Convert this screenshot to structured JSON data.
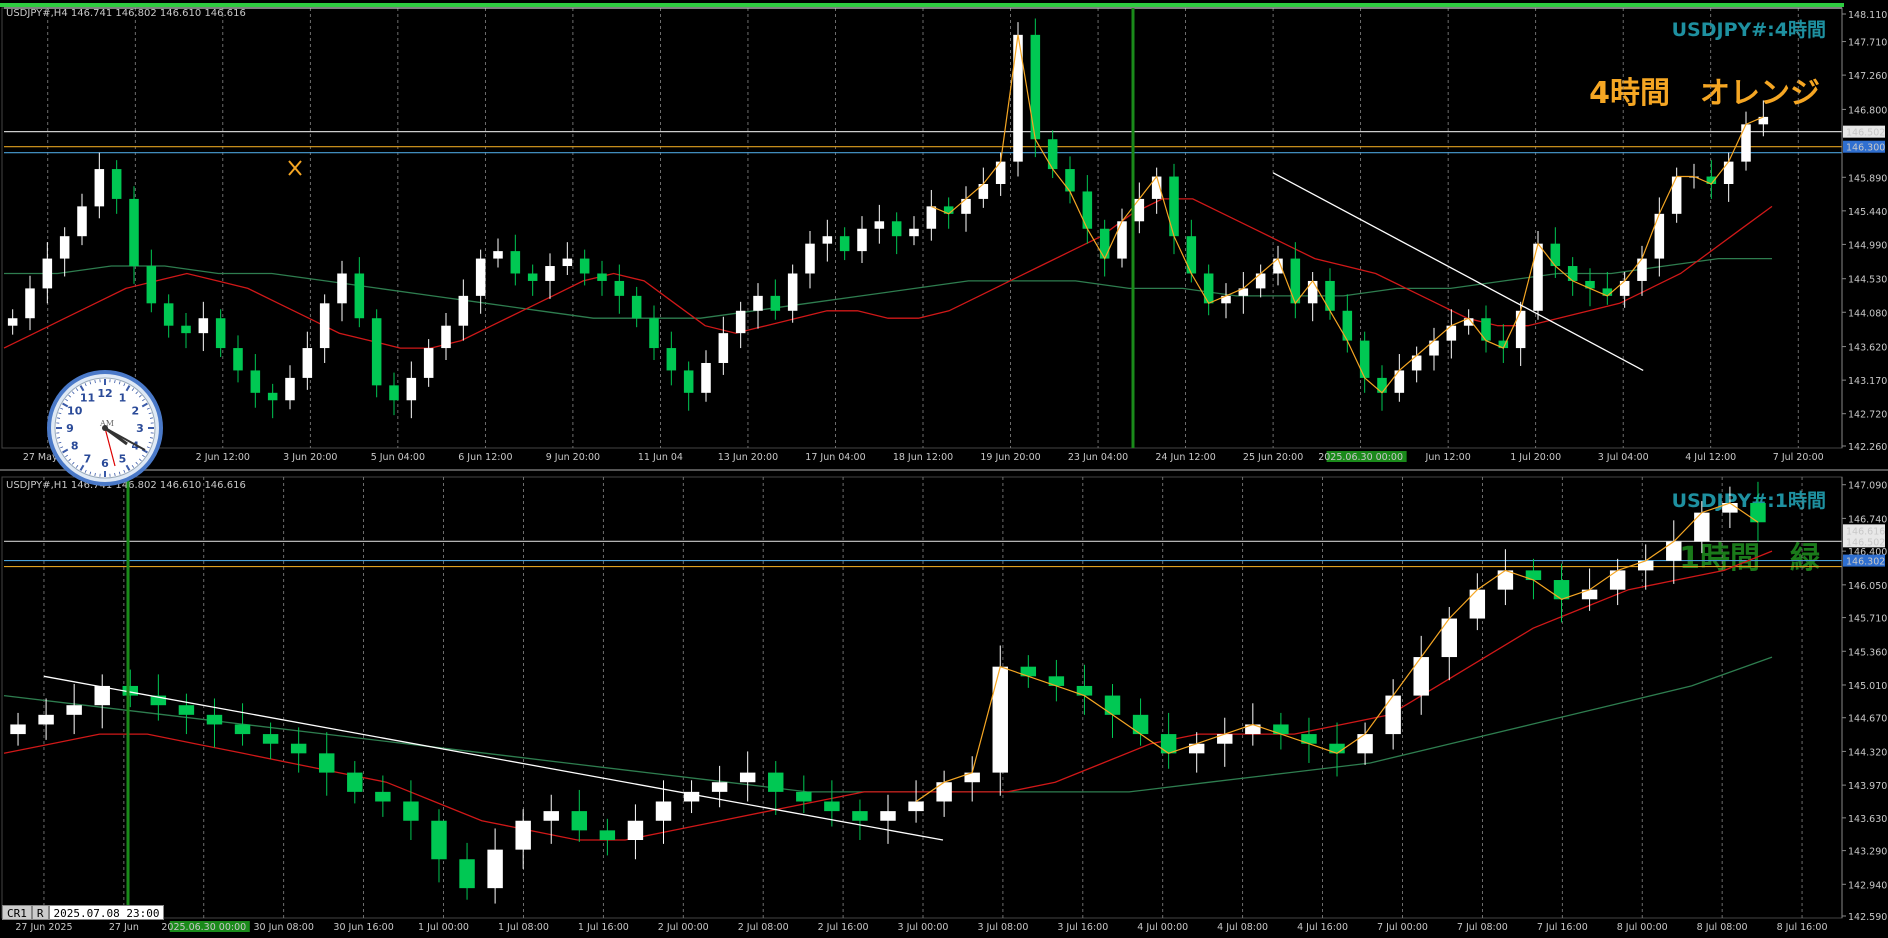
{
  "window": {
    "top_panel_header": "USDJPY#,H4  146.741 146.802 146.610 146.616",
    "bottom_panel_header": "USDJPY#,H1  146.741 146.802 146.610 146.616"
  },
  "chart_data": [
    {
      "type": "candlestick",
      "symbol": "USDJPY#",
      "timeframe": "H4",
      "overlay_title": "USDJPY#:4時間",
      "overlay_note": "4時間　オレンジ",
      "y_ticks": [
        "148.110",
        "147.710",
        "147.260",
        "146.800",
        "146.502",
        "146.300",
        "145.890",
        "145.440",
        "144.990",
        "144.530",
        "144.080",
        "143.620",
        "143.170",
        "142.720",
        "142.260"
      ],
      "price_labels": [
        "146.616",
        "146.502",
        "146.300"
      ],
      "ylim": [
        142.26,
        148.16
      ],
      "x_tick_labels": [
        "27 May 20",
        "04:00",
        "2 Jun 12:00",
        "3 Jun 20:00",
        "5 Jun 04:00",
        "6 Jun 12:00",
        "9 Jun 20:00",
        "11 Jun 04",
        "13 Jun 20:00",
        "17 Jun 04:00",
        "18 Jun 12:00",
        "19 Jun 20:00",
        "23 Jun 04:00",
        "24 Jun 12:00",
        "25 Jun 20:00",
        "2025.06.30 00:00",
        "Jun 12:00",
        "1 Jul 20:00",
        "3 Jul 04:00",
        "4 Jul 12:00",
        "7 Jul 20:00"
      ],
      "highlight_x_label": "2025.06.30 00:00",
      "close_series_approx": [
        144.0,
        144.4,
        144.8,
        145.1,
        145.5,
        146.0,
        145.6,
        144.7,
        144.2,
        143.9,
        143.8,
        144.0,
        143.6,
        143.3,
        143.0,
        142.9,
        143.2,
        143.6,
        144.2,
        144.6,
        144.0,
        143.1,
        142.9,
        143.2,
        143.6,
        143.9,
        144.3,
        144.8,
        144.9,
        144.6,
        144.5,
        144.7,
        144.8,
        144.6,
        144.5,
        144.3,
        144.0,
        143.6,
        143.3,
        143.0,
        143.4,
        143.8,
        144.1,
        144.3,
        144.1,
        144.6,
        145.0,
        145.1,
        144.9,
        145.2,
        145.3,
        145.1,
        145.2,
        145.5,
        145.4,
        145.6,
        145.8,
        146.1,
        147.8,
        146.4,
        146.0,
        145.7,
        145.2,
        144.8,
        145.3,
        145.6,
        145.9,
        145.1,
        144.6,
        144.2,
        144.3,
        144.4,
        144.6,
        144.8,
        144.2,
        144.5,
        144.1,
        143.7,
        143.2,
        143.0,
        143.3,
        143.5,
        143.7,
        143.9,
        144.0,
        143.7,
        143.6,
        144.1,
        145.0,
        144.7,
        144.5,
        144.4,
        144.3,
        144.5,
        144.8,
        145.4,
        145.9,
        145.9,
        145.8,
        146.1,
        146.6,
        146.7
      ],
      "ma_red_approx": [
        143.6,
        143.8,
        144.0,
        144.2,
        144.4,
        144.5,
        144.6,
        144.5,
        144.4,
        144.2,
        144.0,
        143.8,
        143.7,
        143.6,
        143.6,
        143.7,
        143.9,
        144.1,
        144.3,
        144.5,
        144.6,
        144.5,
        144.2,
        143.9,
        143.8,
        143.9,
        144.0,
        144.1,
        144.1,
        144.0,
        144.0,
        144.1,
        144.3,
        144.5,
        144.7,
        144.9,
        145.1,
        145.4,
        145.6,
        145.6,
        145.4,
        145.2,
        145.0,
        144.8,
        144.7,
        144.6,
        144.4,
        144.2,
        144.0,
        143.9,
        143.9,
        144.0,
        144.1,
        144.2,
        144.4,
        144.6,
        144.9,
        145.2,
        145.5
      ],
      "ma_green_approx": [
        144.6,
        144.6,
        144.7,
        144.7,
        144.6,
        144.6,
        144.5,
        144.4,
        144.3,
        144.2,
        144.1,
        144.0,
        144.0,
        144.0,
        144.1,
        144.2,
        144.3,
        144.4,
        144.5,
        144.5,
        144.5,
        144.4,
        144.4,
        144.3,
        144.3,
        144.3,
        144.4,
        144.4,
        144.5,
        144.6,
        144.6,
        144.7,
        144.8,
        144.8
      ],
      "horizontal_lines": [
        148.16,
        146.502,
        146.3,
        146.22
      ],
      "trendline": {
        "x_from": "25 Jun 20:00",
        "y_from": 145.95,
        "x_to": "3 Jul 04:00",
        "y_to": 143.3
      }
    },
    {
      "type": "candlestick",
      "symbol": "USDJPY#",
      "timeframe": "H1",
      "overlay_title": "USDJPY#:1時間",
      "overlay_note": "1時間　緑",
      "y_ticks": [
        "147.090",
        "146.740",
        "146.616",
        "146.502",
        "146.400",
        "146.302",
        "146.050",
        "145.710",
        "145.360",
        "145.010",
        "144.670",
        "144.320",
        "143.970",
        "143.630",
        "143.290",
        "142.940",
        "142.590"
      ],
      "price_labels": [
        "146.616",
        "146.502",
        "146.302"
      ],
      "ylim": [
        142.59,
        147.17
      ],
      "x_tick_labels": [
        "27 Jun 2025",
        "27 Jun",
        "2025.06.30 00:00",
        "30 Jun 08:00",
        "30 Jun 16:00",
        "1 Jul 00:00",
        "1 Jul 08:00",
        "1 Jul 16:00",
        "2 Jul 00:00",
        "2 Jul 08:00",
        "2 Jul 16:00",
        "3 Jul 00:00",
        "3 Jul 08:00",
        "3 Jul 16:00",
        "4 Jul 00:00",
        "4 Jul 08:00",
        "4 Jul 16:00",
        "7 Jul 00:00",
        "7 Jul 08:00",
        "7 Jul 16:00",
        "8 Jul 00:00",
        "8 Jul 08:00",
        "8 Jul 16:00"
      ],
      "highlight_x_label": "2025.06.30 00:00",
      "close_series_approx": [
        144.6,
        144.7,
        144.8,
        145.0,
        144.9,
        144.8,
        144.7,
        144.6,
        144.5,
        144.4,
        144.3,
        144.1,
        143.9,
        143.8,
        143.6,
        143.2,
        142.9,
        143.3,
        143.6,
        143.7,
        143.5,
        143.4,
        143.6,
        143.8,
        143.9,
        144.0,
        144.1,
        143.9,
        143.8,
        143.7,
        143.6,
        143.7,
        143.8,
        144.0,
        144.1,
        145.2,
        145.1,
        145.0,
        144.9,
        144.7,
        144.5,
        144.3,
        144.4,
        144.5,
        144.6,
        144.5,
        144.4,
        144.3,
        144.5,
        144.9,
        145.3,
        145.7,
        146.0,
        146.2,
        146.1,
        145.9,
        146.0,
        146.2,
        146.3,
        146.5,
        146.8,
        146.9,
        146.7
      ],
      "ma_red_approx": [
        144.3,
        144.4,
        144.5,
        144.5,
        144.4,
        144.3,
        144.2,
        144.1,
        144.0,
        143.8,
        143.6,
        143.5,
        143.4,
        143.4,
        143.5,
        143.6,
        143.7,
        143.8,
        143.9,
        143.9,
        143.9,
        143.9,
        144.0,
        144.2,
        144.4,
        144.5,
        144.5,
        144.5,
        144.6,
        144.7,
        145.0,
        145.3,
        145.6,
        145.8,
        146.0,
        146.1,
        146.2,
        146.4
      ],
      "ma_green_approx": [
        144.9,
        144.8,
        144.7,
        144.6,
        144.5,
        144.4,
        144.3,
        144.2,
        144.1,
        144.0,
        143.9,
        143.9,
        143.9,
        143.9,
        143.9,
        144.0,
        144.1,
        144.2,
        144.4,
        144.6,
        144.8,
        145.0,
        145.3
      ],
      "horizontal_lines": [
        146.502,
        146.302,
        146.24
      ],
      "trendline": {
        "x_from": "27 Jun 2025",
        "y_from": 145.1,
        "x_to": "3 Jul 00:00",
        "y_to": 143.4
      }
    }
  ],
  "clock": {
    "label": "AM",
    "numbers": [
      "12",
      "1",
      "2",
      "3",
      "4",
      "5",
      "6",
      "7",
      "8",
      "9",
      "10",
      "11"
    ]
  },
  "time_field": {
    "btn_cr": "CR1",
    "btn_r": "R",
    "value": "2025.07.08 23:00"
  },
  "colors": {
    "background": "#000000",
    "bull": "#ffffff",
    "bear": "#00c853",
    "ma_red": "#d01818",
    "ma_green": "#2e7d4f",
    "zigzag": "#f5a623",
    "title_text": "#1e90a0",
    "h4_note": "#f5a623",
    "h1_note": "#1a7a1a",
    "grid": "#888888",
    "vertical_marker": "#1a8a1a",
    "frame_top": "#2ecc40"
  }
}
